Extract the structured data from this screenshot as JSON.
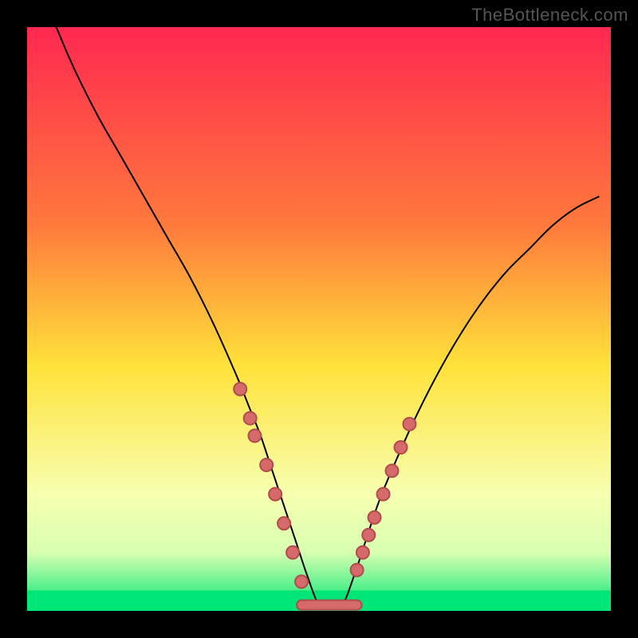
{
  "watermark": {
    "text": "TheBottleneck.com"
  },
  "colors": {
    "frame": "#000000",
    "curve": "#000000",
    "marker_fill": "#d66a6a",
    "marker_stroke": "#b14c4c",
    "line_fill": "#d66a6a",
    "line_stroke": "#b14c4c",
    "gradient_top": "#ff2850",
    "gradient_yellow": "#ffe23a",
    "gradient_pale": "#f7ffb0",
    "gradient_green": "#00e676"
  },
  "layout": {
    "outer_size": 800,
    "inner_x": 34,
    "inner_y": 34,
    "inner_w": 732,
    "inner_h": 732
  },
  "chart_data": {
    "type": "line",
    "title": "",
    "xlabel": "",
    "ylabel": "",
    "xlim": [
      0,
      100
    ],
    "ylim": [
      0,
      100
    ],
    "series": [
      {
        "name": "curve",
        "x": [
          5,
          8,
          12,
          16,
          20,
          24,
          28,
          32,
          36,
          38,
          40,
          42,
          44,
          46,
          48,
          50,
          52,
          54,
          56,
          58,
          60,
          62,
          66,
          70,
          74,
          78,
          82,
          86,
          90,
          94,
          98
        ],
        "values": [
          100,
          93,
          85,
          78,
          71,
          64,
          57,
          49,
          40,
          35,
          30,
          24,
          18,
          12,
          6,
          1,
          0.5,
          1,
          6,
          12,
          18,
          23,
          32,
          40,
          47,
          53,
          58,
          62,
          66,
          69,
          71
        ]
      }
    ],
    "markers_left": {
      "name": "markers-left",
      "x": [
        36.5,
        38.2,
        39.0,
        41.0,
        42.5,
        44.0,
        45.5,
        47.0
      ],
      "values": [
        38.0,
        33.0,
        30.0,
        25.0,
        20.0,
        15.0,
        10.0,
        5.0
      ]
    },
    "markers_right": {
      "name": "markers-right",
      "x": [
        56.5,
        57.5,
        58.5,
        59.5,
        61.0,
        62.5,
        64.0,
        65.5
      ],
      "values": [
        7.0,
        10.0,
        13.0,
        16.0,
        20.0,
        24.0,
        28.0,
        32.0
      ]
    },
    "bottom_line": {
      "name": "bottom-connector",
      "x": [
        47.0,
        56.5
      ],
      "values": [
        1.0,
        1.0
      ]
    }
  }
}
